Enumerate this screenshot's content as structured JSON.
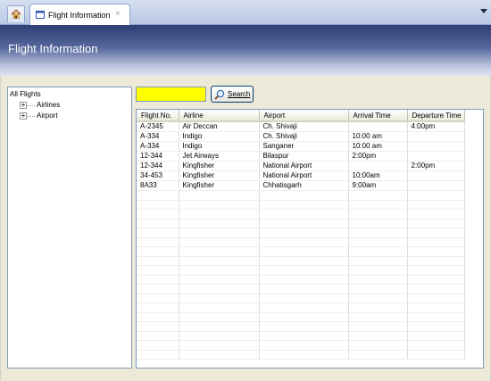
{
  "tab": {
    "label": "Flight Information",
    "close": "×"
  },
  "header": {
    "title": "Flight Information"
  },
  "tree": {
    "root": "All Flights",
    "nodes": [
      {
        "label": "Airlines",
        "expander": "+"
      },
      {
        "label": "Airport",
        "expander": "+"
      }
    ]
  },
  "search": {
    "value": "",
    "button_label": "Search"
  },
  "grid": {
    "columns": [
      "Flight No.",
      "Airline",
      "Airport",
      "Arrival Time",
      "Departure Time"
    ],
    "rows": [
      [
        "A-2345",
        "Air Deccan",
        "Ch. Shivaji",
        "",
        "4:00pm"
      ],
      [
        "A-334",
        "Indigo",
        "Ch. Shivaji",
        "10:00 am",
        ""
      ],
      [
        "A-334",
        "Indigo",
        "Sanganer",
        "10:00 am",
        ""
      ],
      [
        "12-344",
        "Jet Airways",
        "Bilaspur",
        "2:00pm",
        ""
      ],
      [
        "12-344",
        "Kingfisher",
        "National Airport",
        "",
        "2:00pm"
      ],
      [
        "34-453",
        "Kingfisher",
        "National Airport",
        "10:00am",
        ""
      ],
      [
        "8A33",
        "Kingfisher",
        "Chhatisgarh",
        "9:00am",
        ""
      ]
    ]
  },
  "colors": {
    "search_bg": "#ffff00",
    "header_top": "#2e3f73",
    "panel_bg": "#ece9d8"
  },
  "icons": {
    "home": "home-icon",
    "search": "magnifier-icon",
    "tab": "window-icon"
  }
}
